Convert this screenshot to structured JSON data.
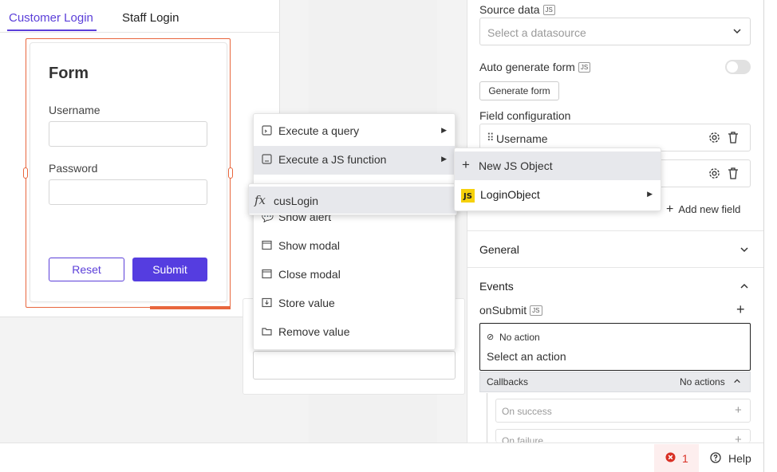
{
  "tabs": {
    "customer": "Customer Login",
    "staff": "Staff Login"
  },
  "form": {
    "title": "Form",
    "username_label": "Username",
    "password_label": "Password",
    "reset_label": "Reset",
    "submit_label": "Submit"
  },
  "props": {
    "source_data_label": "Source data",
    "source_data_placeholder": "Select a datasource",
    "auto_generate_label": "Auto generate form",
    "generate_button": "Generate form",
    "field_config_label": "Field configuration",
    "fields": [
      "Username"
    ],
    "add_field": "Add new field",
    "general": "General",
    "events": "Events",
    "on_submit": "onSubmit",
    "no_action": "No action",
    "select_action": "Select an action",
    "callbacks": "Callbacks",
    "no_actions": "No actions",
    "on_success": "On success",
    "on_failure": "On failure",
    "js_badge": "JS"
  },
  "action_menu": [
    {
      "label": "Execute a query",
      "icon": "query-icon",
      "submenu": true
    },
    {
      "label": "Execute a JS function",
      "icon": "js-function-icon",
      "submenu": true
    },
    {
      "label": "Show alert",
      "icon": "alert-icon"
    },
    {
      "label": "Show modal",
      "icon": "modal-icon"
    },
    {
      "label": "Close modal",
      "icon": "modal-icon"
    },
    {
      "label": "Store value",
      "icon": "store-icon"
    },
    {
      "label": "Remove value",
      "icon": "folder-icon"
    }
  ],
  "js_submenu": {
    "new": "New JS Object",
    "object": "LoginObject",
    "badge": "JS"
  },
  "function_menu": {
    "fx": "fx",
    "item": "cusLogin"
  },
  "bottom": {
    "error_count": "1",
    "help": "Help"
  },
  "colors": {
    "accent": "#553de0",
    "selection": "#e8663d",
    "error": "#d93025"
  }
}
